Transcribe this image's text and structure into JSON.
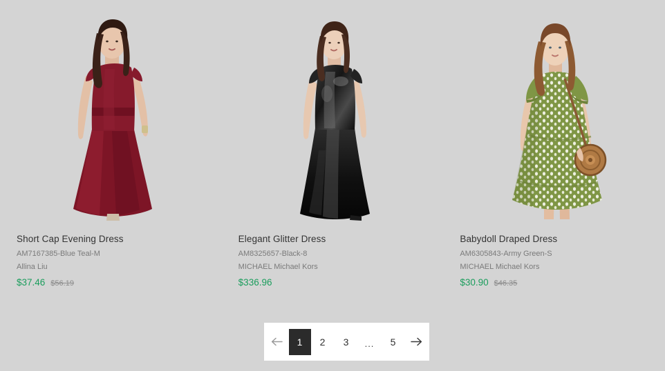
{
  "page": {
    "background_color": "#d4d4d4",
    "sale_price_color": "#1a9d5c",
    "active_page_color": "#2b2b2b"
  },
  "products": [
    {
      "title": "Short Cap Evening Dress",
      "sku": "AM7167385-Blue Teal-M",
      "brand": "Allina Liu",
      "price": "$37.46",
      "original_price": "$56.19",
      "image_alt": "model-in-burgundy-mermaid-evening-gown"
    },
    {
      "title": "Elegant Glitter Dress",
      "sku": "AM8325657-Black-8",
      "brand": "MICHAEL Michael Kors",
      "price": "$336.96",
      "original_price": "",
      "image_alt": "model-in-black-sequin-evening-gown"
    },
    {
      "title": "Babydoll Draped Dress",
      "sku": "AM6305843-Army Green-S",
      "brand": "MICHAEL Michael Kors",
      "price": "$30.90",
      "original_price": "$46.35",
      "image_alt": "model-in-green-dotted-babydoll-dress-with-rattan-bag"
    }
  ],
  "pagination": {
    "prev_label": "←",
    "next_label": "→",
    "ellipsis": "...",
    "pages": [
      "1",
      "2",
      "3",
      "5"
    ],
    "current_page": "1"
  }
}
